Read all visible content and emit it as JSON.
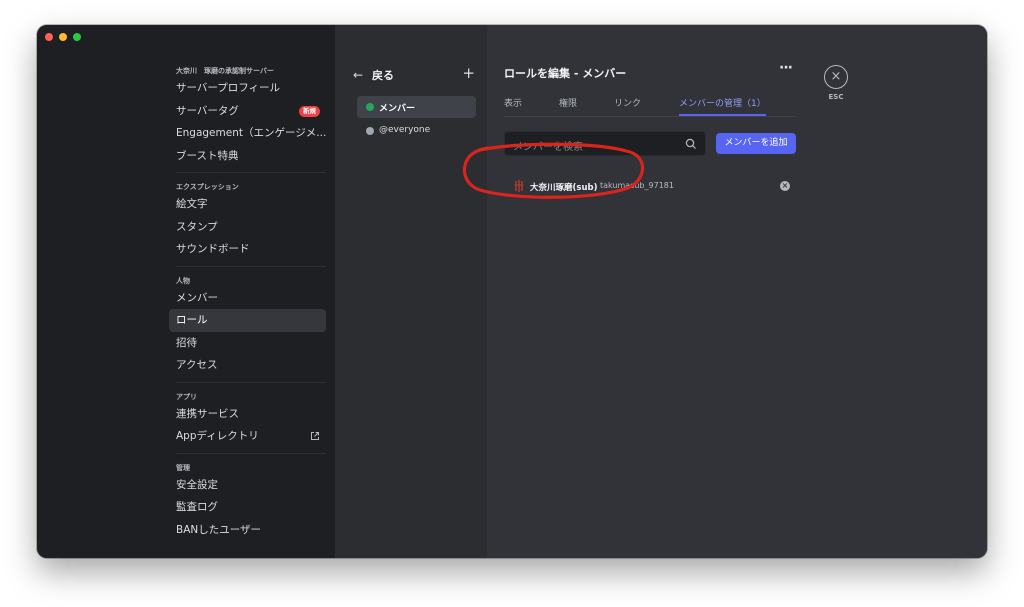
{
  "sidebar": {
    "server_name": "大奈川　琢磨の承認制サーバー",
    "groups": [
      {
        "header": null,
        "items": [
          {
            "label": "サーバープロフィール"
          },
          {
            "label": "サーバータグ",
            "badge": "新規"
          },
          {
            "label": "Engagement（エンゲージメ..."
          },
          {
            "label": "ブースト特典"
          }
        ]
      },
      {
        "header": "エクスプレッション",
        "items": [
          {
            "label": "絵文字"
          },
          {
            "label": "スタンプ"
          },
          {
            "label": "サウンドボード"
          }
        ]
      },
      {
        "header": "人物",
        "items": [
          {
            "label": "メンバー"
          },
          {
            "label": "ロール",
            "active": true
          },
          {
            "label": "招待"
          },
          {
            "label": "アクセス"
          }
        ]
      },
      {
        "header": "アプリ",
        "items": [
          {
            "label": "連携サービス"
          },
          {
            "label": "Appディレクトリ",
            "external_icon": "external-link-icon"
          }
        ]
      },
      {
        "header": "管理",
        "items": [
          {
            "label": "安全設定"
          },
          {
            "label": "監査ログ"
          },
          {
            "label": "BANしたユーザー"
          }
        ]
      }
    ]
  },
  "roles_panel": {
    "back_label": "戻る",
    "add_icon": "plus-icon",
    "roles": [
      {
        "label": "メンバー",
        "color": "#23a55a",
        "active": true
      },
      {
        "label": "@everyone",
        "color": "#99aab5",
        "active": false
      }
    ]
  },
  "main": {
    "title": "ロールを編集 - メンバー",
    "tabs": [
      {
        "label": "表示"
      },
      {
        "label": "権限"
      },
      {
        "label": "リンク"
      },
      {
        "label": "メンバーの管理（1）",
        "active": true
      }
    ],
    "search": {
      "placeholder": "メンバーを検索"
    },
    "add_member_label": "メンバーを追加",
    "members": [
      {
        "display_name": "大奈川琢磨(sub)",
        "username": "takumasub_97181"
      }
    ]
  },
  "esc": {
    "label": "ESC"
  },
  "colors": {
    "accent": "#5865f2",
    "annotation": "#d9251c"
  }
}
